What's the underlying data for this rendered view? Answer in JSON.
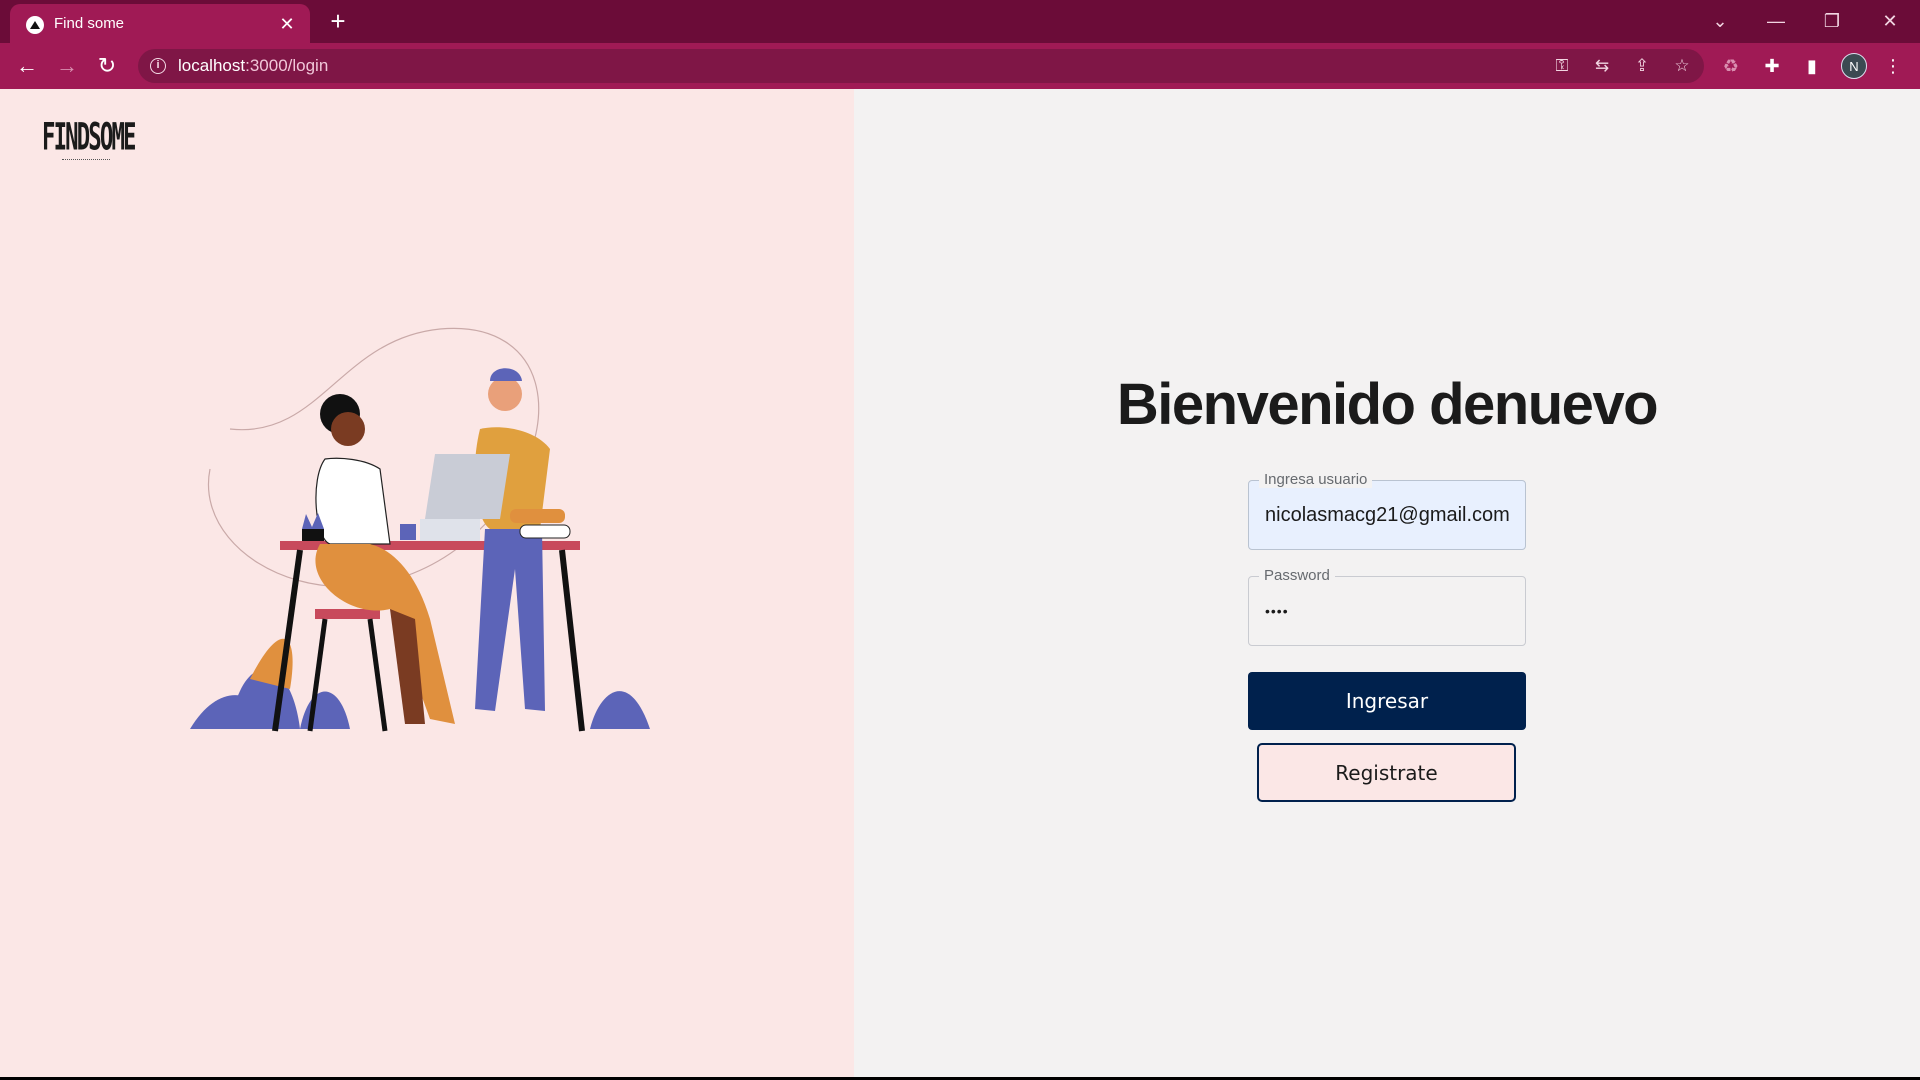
{
  "browser": {
    "tab_title": "Find some",
    "tab_close": "✕",
    "new_tab": "+",
    "url_host": "localhost",
    "url_path": ":3000/login",
    "profile_initial": "N"
  },
  "page": {
    "logo_text": "FINDSOME",
    "heading": "Bienvenido denuevo",
    "username_field": {
      "label": "Ingresa usuario",
      "value": "nicolasmacg21@gmail.com"
    },
    "password_field": {
      "label": "Password",
      "value": "••••"
    },
    "login_button": "Ingresar",
    "register_button": "Registrate"
  },
  "colors": {
    "tabbar": "#6b0c38",
    "toolbar": "#a01a55",
    "left_panel": "#fbe7e6",
    "right_panel": "#f3f2f2",
    "primary_button": "#00214d"
  }
}
